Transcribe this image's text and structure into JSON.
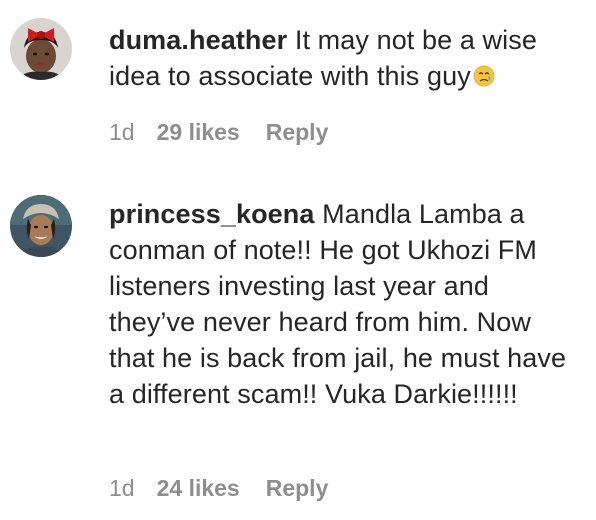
{
  "comments": [
    {
      "username": "duma.heather",
      "text": "It may not be a wise idea to associate with this guy",
      "emoji": "crying-face-emoji",
      "time": "1d",
      "likes": "29 likes",
      "reply": "Reply"
    },
    {
      "username": "princess_koena",
      "text": "Mandla Lamba a conman of note!! He got Ukhozi FM listeners investing last year and they’ve never heard from him. Now that he is back from jail, he must have a different scam!! Vuka Darkie!!!!!!",
      "time": "1d",
      "likes": "24 likes",
      "reply": "Reply"
    }
  ]
}
